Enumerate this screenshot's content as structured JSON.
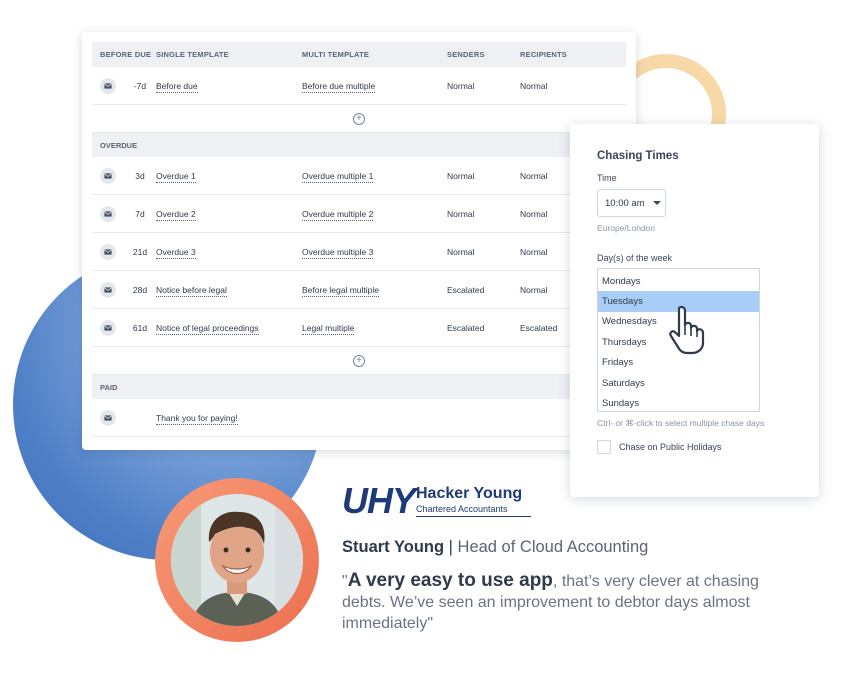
{
  "table": {
    "headers": [
      "BEFORE DUE",
      "SINGLE TEMPLATE",
      "MULTI TEMPLATE",
      "SENDERS",
      "RECIPIENTS"
    ],
    "before_due_rows": [
      {
        "days": "-7d",
        "single": "Before due",
        "multi": "Before due multiple",
        "senders": "Normal",
        "recipients": "Normal"
      }
    ],
    "overdue_label": "OVERDUE",
    "overdue_rows": [
      {
        "days": "3d",
        "single": "Overdue 1",
        "multi": "Overdue multiple 1",
        "senders": "Normal",
        "recipients": "Normal"
      },
      {
        "days": "7d",
        "single": "Overdue 2",
        "multi": "Overdue multiple 2",
        "senders": "Normal",
        "recipients": "Normal"
      },
      {
        "days": "21d",
        "single": "Overdue 3",
        "multi": "Overdue multiple 3",
        "senders": "Normal",
        "recipients": "Normal"
      },
      {
        "days": "28d",
        "single": "Notice before legal",
        "multi": "Before legal multiple",
        "senders": "Escalated",
        "recipients": "Normal"
      },
      {
        "days": "61d",
        "single": "Notice of legal proceedings",
        "multi": "Legal multiple",
        "senders": "Escalated",
        "recipients": "Escalated"
      }
    ],
    "paid_label": "PAID",
    "paid_rows": [
      {
        "days": "",
        "single": "Thank you for paying!",
        "multi": "",
        "senders": "",
        "recipients": ""
      }
    ],
    "add_symbol": "+"
  },
  "chasing": {
    "title": "Chasing Times",
    "time_label": "Time",
    "time_value": "10:00 am",
    "timezone": "Europe/London",
    "days_label": "Day(s) of the week",
    "days": [
      "Mondays",
      "Tuesdays",
      "Wednesdays",
      "Thursdays",
      "Fridays",
      "Saturdays",
      "Sundays"
    ],
    "selected_day": "Tuesdays",
    "hint": "Ctrl- or ⌘-click to select multiple chase days",
    "public_holidays_label": "Chase on Public Holidays",
    "public_holidays_checked": false
  },
  "testimonial": {
    "logo_mark": "UHY",
    "logo_name": "Hacker Young",
    "logo_sub": "Chartered Accountants",
    "person_name": "Stuart Young",
    "separator": " | ",
    "person_role": "Head of Cloud Accounting",
    "quote_open": "\"",
    "quote_lead": "A very easy to use app",
    "quote_rest": ", that’s very clever at chasing debts. We’ve seen an improvement to debtor days almost immediately\""
  },
  "colors": {
    "brand_blue": "#1e3a78",
    "selected_option": "#a8cdf6",
    "avatar_ring": "#ec6f4f",
    "backdrop_blue": "#4f7fc6",
    "backdrop_ring": "#f7d9a8"
  },
  "icons": {
    "row_icon": "mail-icon",
    "add_icon": "plus-circle-icon",
    "pointer": "hand-pointer-icon"
  }
}
